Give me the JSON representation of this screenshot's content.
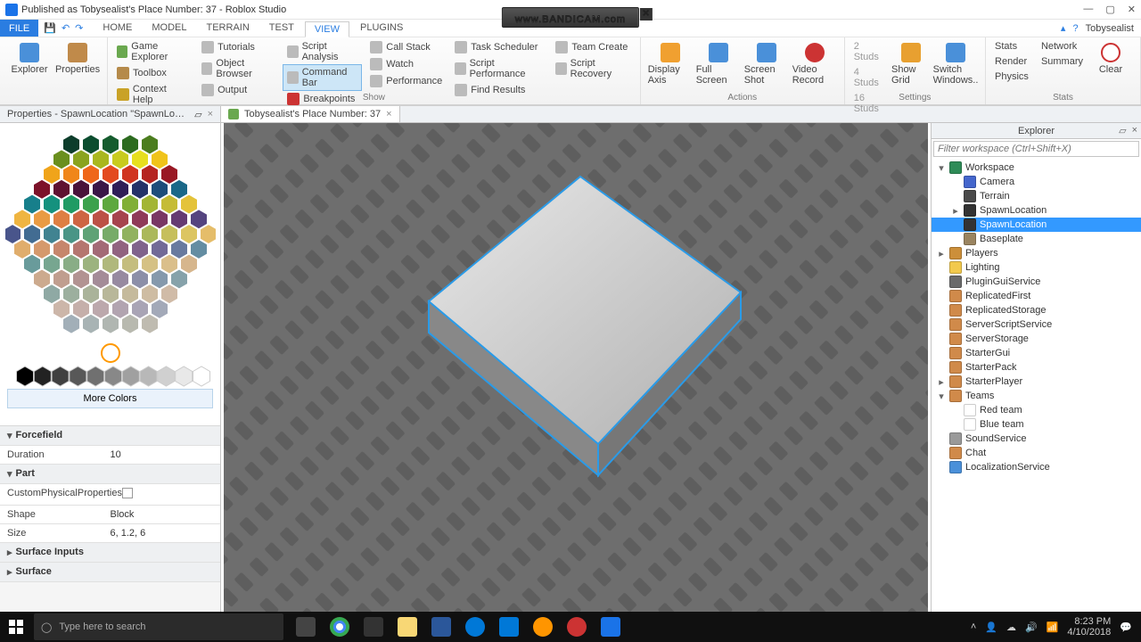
{
  "window": {
    "title": "Published as Tobysealist's Place Number: 37 - Roblox Studio"
  },
  "menubar": {
    "file": "FILE",
    "tabs": [
      "HOME",
      "MODEL",
      "TERRAIN",
      "TEST",
      "VIEW",
      "PLUGINS"
    ],
    "activeTab": "VIEW",
    "user": "Tobysealist"
  },
  "ribbon": {
    "explorer": "Explorer",
    "properties": "Properties",
    "gameExplorer": "Game Explorer",
    "toolbox": "Toolbox",
    "contextHelp": "Context Help",
    "tutorials": "Tutorials",
    "objectBrowser": "Object Browser",
    "output": "Output",
    "scriptAnalysis": "Script Analysis",
    "commandBar": "Command Bar",
    "breakpoints": "Breakpoints",
    "callStack": "Call Stack",
    "watch": "Watch",
    "performance": "Performance",
    "taskScheduler": "Task Scheduler",
    "scriptPerformance": "Script Performance",
    "findResults": "Find Results",
    "teamCreate": "Team Create",
    "scriptRecovery": "Script Recovery",
    "groupShow": "Show",
    "displayAxis": "Display Axis",
    "fullScreen": "Full Screen",
    "screenShot": "Screen Shot",
    "videoRecord": "Video Record",
    "groupActions": "Actions",
    "studs2": "2 Studs",
    "studs4": "4 Studs",
    "studs16": "16 Studs",
    "showGrid": "Show Grid",
    "switchWindows": "Switch Windows..",
    "groupSettings": "Settings",
    "stats": "Stats",
    "render": "Render",
    "physics": "Physics",
    "network": "Network",
    "summary": "Summary",
    "groupStats": "Stats",
    "clear": "Clear"
  },
  "doctabs": {
    "prop": "Properties - SpawnLocation \"SpawnLocation\"",
    "place": "Tobysealist's Place Number: 37"
  },
  "colorpicker": {
    "moreColors": "More Colors"
  },
  "properties": {
    "section1": "Forcefield",
    "duration_k": "Duration",
    "duration_v": "10",
    "section2": "Part",
    "custom_k": "CustomPhysicalProperties",
    "shape_k": "Shape",
    "shape_v": "Block",
    "size_k": "Size",
    "size_v": "6, 1.2, 6",
    "section3": "Surface Inputs",
    "section4": "Surface"
  },
  "explorer": {
    "title": "Explorer",
    "filterPlaceholder": "Filter workspace (Ctrl+Shift+X)",
    "nodes": [
      {
        "depth": 0,
        "exp": "▾",
        "label": "Workspace",
        "color": "#2e8b57",
        "sel": false
      },
      {
        "depth": 1,
        "exp": "",
        "label": "Camera",
        "color": "#4466cc",
        "sel": false
      },
      {
        "depth": 1,
        "exp": "",
        "label": "Terrain",
        "color": "#4a4a4a",
        "sel": false
      },
      {
        "depth": 1,
        "exp": "▸",
        "label": "SpawnLocation",
        "color": "#333",
        "sel": false
      },
      {
        "depth": 1,
        "exp": "",
        "label": "SpawnLocation",
        "color": "#333",
        "sel": true
      },
      {
        "depth": 1,
        "exp": "",
        "label": "Baseplate",
        "color": "#9a8460",
        "sel": false
      },
      {
        "depth": 0,
        "exp": "▸",
        "label": "Players",
        "color": "#cc8f3a",
        "sel": false
      },
      {
        "depth": 0,
        "exp": "",
        "label": "Lighting",
        "color": "#f2c94c",
        "sel": false
      },
      {
        "depth": 0,
        "exp": "",
        "label": "PluginGuiService",
        "color": "#6a6a6a",
        "sel": false
      },
      {
        "depth": 0,
        "exp": "",
        "label": "ReplicatedFirst",
        "color": "#d08a4a",
        "sel": false
      },
      {
        "depth": 0,
        "exp": "",
        "label": "ReplicatedStorage",
        "color": "#d08a4a",
        "sel": false
      },
      {
        "depth": 0,
        "exp": "",
        "label": "ServerScriptService",
        "color": "#d08a4a",
        "sel": false
      },
      {
        "depth": 0,
        "exp": "",
        "label": "ServerStorage",
        "color": "#d08a4a",
        "sel": false
      },
      {
        "depth": 0,
        "exp": "",
        "label": "StarterGui",
        "color": "#d08a4a",
        "sel": false
      },
      {
        "depth": 0,
        "exp": "",
        "label": "StarterPack",
        "color": "#d08a4a",
        "sel": false
      },
      {
        "depth": 0,
        "exp": "▸",
        "label": "StarterPlayer",
        "color": "#d08a4a",
        "sel": false
      },
      {
        "depth": 0,
        "exp": "▾",
        "label": "Teams",
        "color": "#d08a4a",
        "sel": false
      },
      {
        "depth": 1,
        "exp": "",
        "label": "Red team",
        "color": "#fff",
        "sel": false
      },
      {
        "depth": 1,
        "exp": "",
        "label": "Blue team",
        "color": "#fff",
        "sel": false
      },
      {
        "depth": 0,
        "exp": "",
        "label": "SoundService",
        "color": "#999",
        "sel": false
      },
      {
        "depth": 0,
        "exp": "",
        "label": "Chat",
        "color": "#d08a4a",
        "sel": false
      },
      {
        "depth": 0,
        "exp": "",
        "label": "LocalizationService",
        "color": "#4a90d9",
        "sel": false
      }
    ]
  },
  "taskbar": {
    "searchPlaceholder": "Type here to search",
    "time": "8:23 PM",
    "date": "4/10/2018"
  },
  "watermark": "www.BANDICAM.com"
}
